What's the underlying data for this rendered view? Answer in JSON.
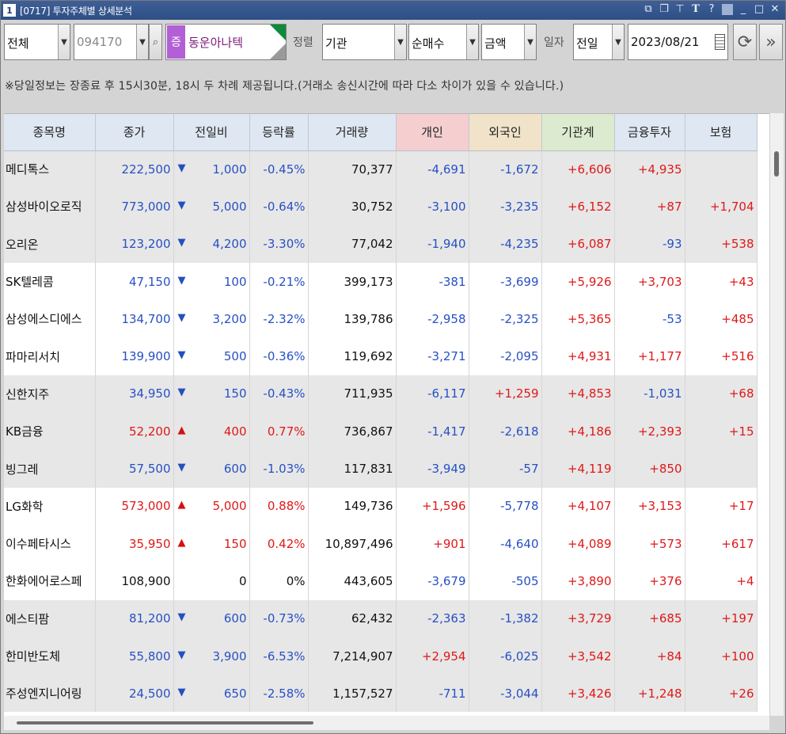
{
  "window": {
    "number": "1",
    "title": "[0717] 투자주체별 상세분석"
  },
  "toolbar": {
    "market": "전체",
    "code": "094170",
    "badge": "증",
    "stock_name": "동운아나텍",
    "sort_label": "정렬",
    "investor": "기관",
    "trade_type": "순매수",
    "unit": "금액",
    "date_label": "일자",
    "period": "전일",
    "date": "2023/08/21"
  },
  "notice": "※당일정보는 장종료 후 15시30분, 18시 두 차례 제공됩니다.(거래소 송신시간에 따라 다소 차이가 있을 수 있습니다.)",
  "colors": {
    "individual_header": "#f5cfcf",
    "foreign_header": "#f1e3c9",
    "institution_header": "#dcebcf",
    "up": "#e01818",
    "down": "#2750c4"
  },
  "table": {
    "headers": [
      "종목명",
      "종가",
      "전일비",
      "등락률",
      "거래량",
      "개인",
      "외국인",
      "기관계",
      "금융투자",
      "보험"
    ],
    "rows": [
      {
        "name": "메디톡스",
        "close": "222,500",
        "dir": "down",
        "change": "1,000",
        "rate": "-0.45%",
        "volume": "70,377",
        "individual": "-4,691",
        "foreign": "-1,672",
        "inst": "+6,606",
        "fin": "+4,935",
        "ins": ""
      },
      {
        "name": "삼성바이오로직",
        "close": "773,000",
        "dir": "down",
        "change": "5,000",
        "rate": "-0.64%",
        "volume": "30,752",
        "individual": "-3,100",
        "foreign": "-3,235",
        "inst": "+6,152",
        "fin": "+87",
        "ins": "+1,704"
      },
      {
        "name": "오리온",
        "close": "123,200",
        "dir": "down",
        "change": "4,200",
        "rate": "-3.30%",
        "volume": "77,042",
        "individual": "-1,940",
        "foreign": "-4,235",
        "inst": "+6,087",
        "fin": "-93",
        "ins": "+538"
      },
      {
        "name": "SK텔레콤",
        "close": "47,150",
        "dir": "down",
        "change": "100",
        "rate": "-0.21%",
        "volume": "399,173",
        "individual": "-381",
        "foreign": "-3,699",
        "inst": "+5,926",
        "fin": "+3,703",
        "ins": "+43"
      },
      {
        "name": "삼성에스디에스",
        "close": "134,700",
        "dir": "down",
        "change": "3,200",
        "rate": "-2.32%",
        "volume": "139,786",
        "individual": "-2,958",
        "foreign": "-2,325",
        "inst": "+5,365",
        "fin": "-53",
        "ins": "+485"
      },
      {
        "name": "파마리서치",
        "close": "139,900",
        "dir": "down",
        "change": "500",
        "rate": "-0.36%",
        "volume": "119,692",
        "individual": "-3,271",
        "foreign": "-2,095",
        "inst": "+4,931",
        "fin": "+1,177",
        "ins": "+516"
      },
      {
        "name": "신한지주",
        "close": "34,950",
        "dir": "down",
        "change": "150",
        "rate": "-0.43%",
        "volume": "711,935",
        "individual": "-6,117",
        "foreign": "+1,259",
        "inst": "+4,853",
        "fin": "-1,031",
        "ins": "+68"
      },
      {
        "name": "KB금융",
        "close": "52,200",
        "dir": "up",
        "change": "400",
        "rate": "0.77%",
        "volume": "736,867",
        "individual": "-1,417",
        "foreign": "-2,618",
        "inst": "+4,186",
        "fin": "+2,393",
        "ins": "+15"
      },
      {
        "name": "빙그레",
        "close": "57,500",
        "dir": "down",
        "change": "600",
        "rate": "-1.03%",
        "volume": "117,831",
        "individual": "-3,949",
        "foreign": "-57",
        "inst": "+4,119",
        "fin": "+850",
        "ins": ""
      },
      {
        "name": "LG화학",
        "close": "573,000",
        "dir": "up",
        "change": "5,000",
        "rate": "0.88%",
        "volume": "149,736",
        "individual": "+1,596",
        "foreign": "-5,778",
        "inst": "+4,107",
        "fin": "+3,153",
        "ins": "+17"
      },
      {
        "name": "이수페타시스",
        "close": "35,950",
        "dir": "up",
        "change": "150",
        "rate": "0.42%",
        "volume": "10,897,496",
        "individual": "+901",
        "foreign": "-4,640",
        "inst": "+4,089",
        "fin": "+573",
        "ins": "+617"
      },
      {
        "name": "한화에어로스페",
        "close": "108,900",
        "dir": "flat",
        "change": "0",
        "rate": "0%",
        "volume": "443,605",
        "individual": "-3,679",
        "foreign": "-505",
        "inst": "+3,890",
        "fin": "+376",
        "ins": "+4"
      },
      {
        "name": "에스티팜",
        "close": "81,200",
        "dir": "down",
        "change": "600",
        "rate": "-0.73%",
        "volume": "62,432",
        "individual": "-2,363",
        "foreign": "-1,382",
        "inst": "+3,729",
        "fin": "+685",
        "ins": "+197"
      },
      {
        "name": "한미반도체",
        "close": "55,800",
        "dir": "down",
        "change": "3,900",
        "rate": "-6.53%",
        "volume": "7,214,907",
        "individual": "+2,954",
        "foreign": "-6,025",
        "inst": "+3,542",
        "fin": "+84",
        "ins": "+100"
      },
      {
        "name": "주성엔지니어링",
        "close": "24,500",
        "dir": "down",
        "change": "650",
        "rate": "-2.58%",
        "volume": "1,157,527",
        "individual": "-711",
        "foreign": "-3,044",
        "inst": "+3,426",
        "fin": "+1,248",
        "ins": "+26"
      }
    ]
  }
}
